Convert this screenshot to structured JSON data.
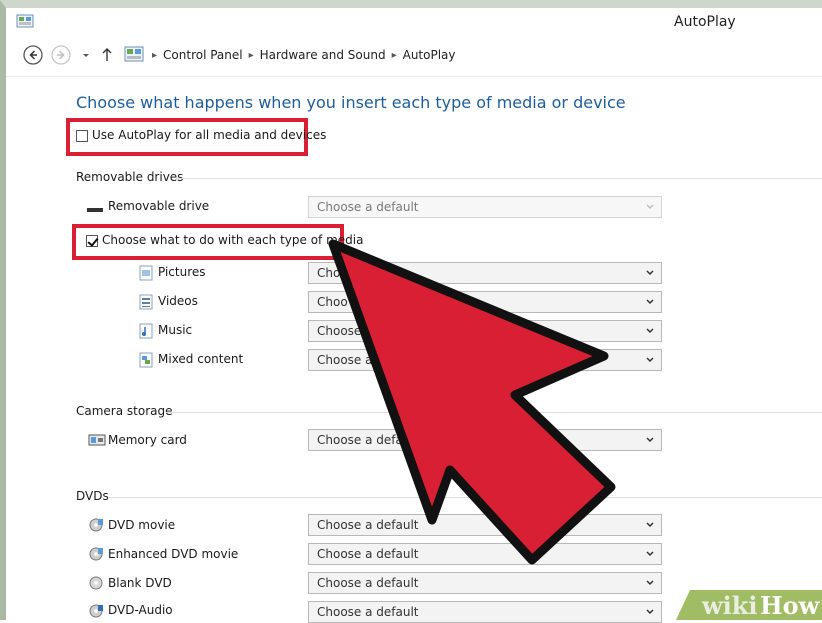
{
  "window": {
    "title": "AutoPlay"
  },
  "breadcrumb": [
    "Control Panel",
    "Hardware and Sound",
    "AutoPlay"
  ],
  "heading": "Choose what happens when you insert each type of media or device",
  "use_autoplay": {
    "label": "Use AutoPlay for all media and devices",
    "checked": false
  },
  "removable": {
    "section": "Removable drives",
    "drive": {
      "label": "Removable drive",
      "value": "Choose a default"
    },
    "per_type": {
      "label": "Choose what to do with each type of media",
      "checked": true
    },
    "types": [
      {
        "label": "Pictures",
        "value": "Choo",
        "icon": "pictures-icon"
      },
      {
        "label": "Videos",
        "value": "Choo",
        "icon": "videos-icon"
      },
      {
        "label": "Music",
        "value": "Choose",
        "icon": "music-icon"
      },
      {
        "label": "Mixed content",
        "value": "Choose a",
        "icon": "mixed-content-icon"
      }
    ]
  },
  "camera": {
    "section": "Camera storage",
    "items": [
      {
        "label": "Memory card",
        "value": "Choose a defau",
        "icon": "memory-card-icon"
      }
    ]
  },
  "dvds": {
    "section": "DVDs",
    "items": [
      {
        "label": "DVD movie",
        "value": "Choose a default",
        "icon": "dvd-movie-icon"
      },
      {
        "label": "Enhanced DVD movie",
        "value": "Choose a default",
        "icon": "enhanced-dvd-icon"
      },
      {
        "label": "Blank DVD",
        "value": "Choose a default",
        "icon": "blank-dvd-icon"
      },
      {
        "label": "DVD-Audio",
        "value": "Choose a default",
        "icon": "dvd-audio-icon"
      }
    ]
  },
  "watermark": {
    "wiki": "wiki",
    "how": "How"
  },
  "colors": {
    "highlight": "#d81f34",
    "heading": "#1e5d9c",
    "watermark_bg": "#8fb24a"
  }
}
